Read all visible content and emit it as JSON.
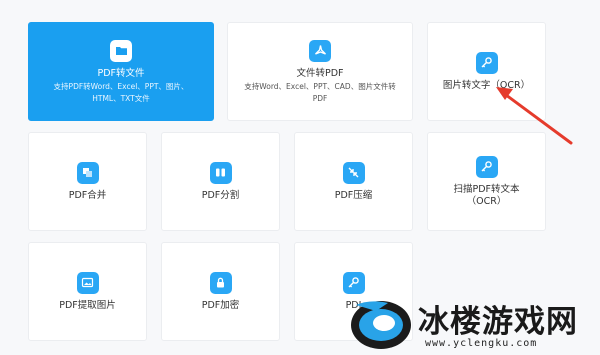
{
  "cards": {
    "pdf_to_file": {
      "title": "PDF转文件",
      "desc1": "支持PDF转Word、Excel、PPT、图片、",
      "desc2": "HTML、TXT文件"
    },
    "file_to_pdf": {
      "title": "文件转PDF",
      "desc1": "支持Word、Excel、PPT、CAD、图片文件转",
      "desc2": "PDF"
    },
    "image_to_text": {
      "title": "图片转文字（OCR）"
    },
    "pdf_merge": {
      "title": "PDF合并"
    },
    "pdf_split": {
      "title": "PDF分割"
    },
    "pdf_compress": {
      "title": "PDF压缩"
    },
    "scan_pdf_to_text": {
      "title1": "扫描PDF转文本",
      "title2": "（OCR）"
    },
    "pdf_extract_images": {
      "title": "PDF提取图片"
    },
    "pdf_encrypt": {
      "title": "PDF加密"
    },
    "pdf_partial": {
      "title": "PDI"
    }
  },
  "watermark": {
    "text": "冰楼游戏网",
    "url": "www.yclengku.com"
  },
  "colors": {
    "accent": "#1a9ff0",
    "icon_blue": "#2aa7f5",
    "arrow_red": "#e53b2c"
  }
}
